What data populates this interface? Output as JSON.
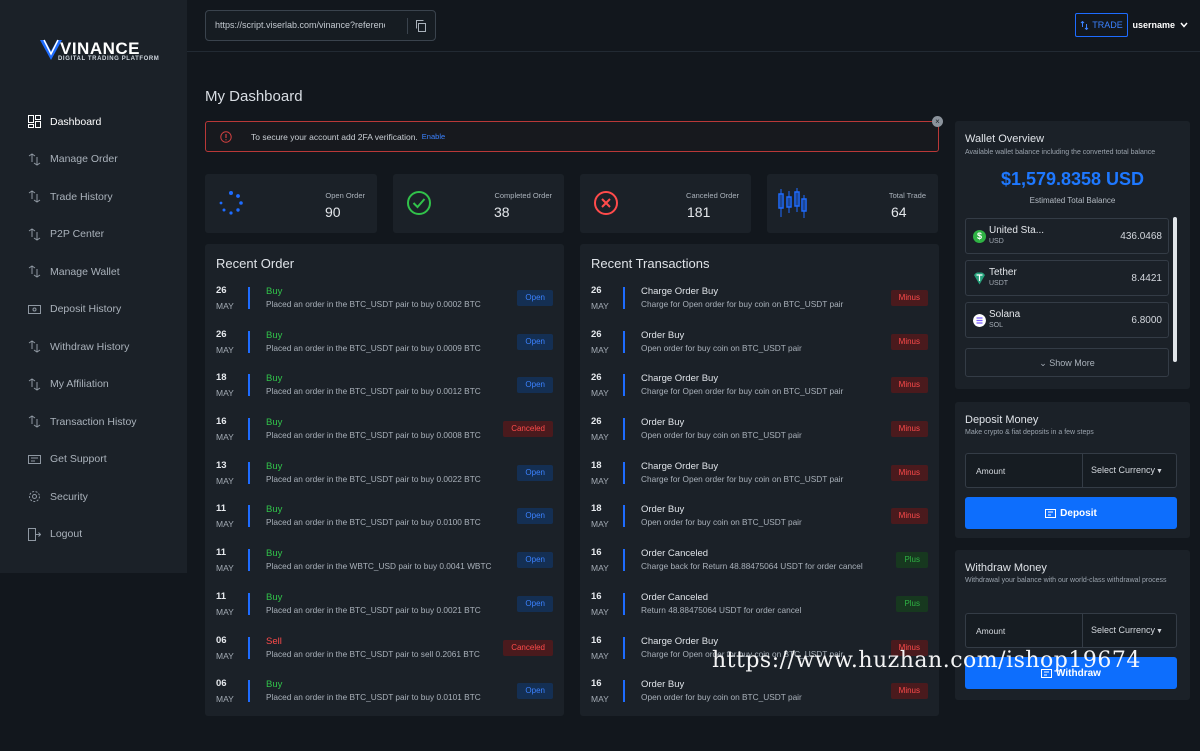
{
  "brand": {
    "name": "VINANCE",
    "tagline": "DIGITAL TRADING PLATFORM"
  },
  "sidebar": {
    "items": [
      {
        "label": "Dashboard",
        "icon": "dashboard-icon"
      },
      {
        "label": "Manage Order",
        "icon": "order-icon"
      },
      {
        "label": "Trade History",
        "icon": "trade-icon"
      },
      {
        "label": "P2P Center",
        "icon": "p2p-icon"
      },
      {
        "label": "Manage Wallet",
        "icon": "wallet-icon"
      },
      {
        "label": "Deposit History",
        "icon": "deposit-icon"
      },
      {
        "label": "Withdraw History",
        "icon": "withdraw-icon"
      },
      {
        "label": "My Affiliation",
        "icon": "affiliation-icon"
      },
      {
        "label": "Transaction Histoy",
        "icon": "transaction-icon"
      },
      {
        "label": "Get Support",
        "icon": "support-icon"
      },
      {
        "label": "Security",
        "icon": "security-icon"
      },
      {
        "label": "Logout",
        "icon": "logout-icon"
      }
    ]
  },
  "topbar": {
    "referral_url": "https://script.viserlab.com/vinance?reference",
    "trade_label": "TRADE",
    "username": "username"
  },
  "page": {
    "title": "My Dashboard",
    "alert_text": "To secure your account add 2FA verification.",
    "alert_link": "Enable"
  },
  "stats": [
    {
      "label": "Open Order",
      "value": "90",
      "icon": "spinner-icon"
    },
    {
      "label": "Completed Order",
      "value": "38",
      "icon": "check-circle-icon"
    },
    {
      "label": "Canceled Order",
      "value": "181",
      "icon": "x-circle-icon"
    },
    {
      "label": "Total Trade",
      "value": "64",
      "icon": "candlestick-icon"
    }
  ],
  "recent_order": {
    "title": "Recent Order",
    "rows": [
      {
        "day": "26",
        "month": "MAY",
        "title": "Buy",
        "desc": "Placed an order in the BTC_USDT pair to buy 0.0002 BTC",
        "status": "Open"
      },
      {
        "day": "26",
        "month": "MAY",
        "title": "Buy",
        "desc": "Placed an order in the BTC_USDT pair to buy 0.0009 BTC",
        "status": "Open"
      },
      {
        "day": "18",
        "month": "MAY",
        "title": "Buy",
        "desc": "Placed an order in the BTC_USDT pair to buy 0.0012 BTC",
        "status": "Open"
      },
      {
        "day": "16",
        "month": "MAY",
        "title": "Buy",
        "desc": "Placed an order in the BTC_USDT pair to buy 0.0008 BTC",
        "status": "Canceled"
      },
      {
        "day": "13",
        "month": "MAY",
        "title": "Buy",
        "desc": "Placed an order in the BTC_USDT pair to buy 0.0022 BTC",
        "status": "Open"
      },
      {
        "day": "11",
        "month": "MAY",
        "title": "Buy",
        "desc": "Placed an order in the BTC_USDT pair to buy 0.0100 BTC",
        "status": "Open"
      },
      {
        "day": "11",
        "month": "MAY",
        "title": "Buy",
        "desc": "Placed an order in the WBTC_USD pair to buy 0.0041 WBTC",
        "status": "Open"
      },
      {
        "day": "11",
        "month": "MAY",
        "title": "Buy",
        "desc": "Placed an order in the BTC_USDT pair to buy 0.0021 BTC",
        "status": "Open"
      },
      {
        "day": "06",
        "month": "MAY",
        "title": "Sell",
        "desc": "Placed an order in the BTC_USDT pair to sell 0.2061 BTC",
        "status": "Canceled"
      },
      {
        "day": "06",
        "month": "MAY",
        "title": "Buy",
        "desc": "Placed an order in the BTC_USDT pair to buy 0.0101 BTC",
        "status": "Open"
      }
    ]
  },
  "recent_transactions": {
    "title": "Recent Transactions",
    "rows": [
      {
        "day": "26",
        "month": "MAY",
        "title": "Charge Order Buy",
        "desc": "Charge for Open order for buy coin on BTC_USDT pair",
        "type": "Minus"
      },
      {
        "day": "26",
        "month": "MAY",
        "title": "Order Buy",
        "desc": "Open order for buy coin on BTC_USDT pair",
        "type": "Minus"
      },
      {
        "day": "26",
        "month": "MAY",
        "title": "Charge Order Buy",
        "desc": "Charge for Open order for buy coin on BTC_USDT pair",
        "type": "Minus"
      },
      {
        "day": "26",
        "month": "MAY",
        "title": "Order Buy",
        "desc": "Open order for buy coin on BTC_USDT pair",
        "type": "Minus"
      },
      {
        "day": "18",
        "month": "MAY",
        "title": "Charge Order Buy",
        "desc": "Charge for Open order for buy coin on BTC_USDT pair",
        "type": "Minus"
      },
      {
        "day": "18",
        "month": "MAY",
        "title": "Order Buy",
        "desc": "Open order for buy coin on BTC_USDT pair",
        "type": "Minus"
      },
      {
        "day": "16",
        "month": "MAY",
        "title": "Order Canceled",
        "desc": "Charge back for Return 48.88475064 USDT for order cancel",
        "type": "Plus"
      },
      {
        "day": "16",
        "month": "MAY",
        "title": "Order Canceled",
        "desc": "Return 48.88475064 USDT for order cancel",
        "type": "Plus"
      },
      {
        "day": "16",
        "month": "MAY",
        "title": "Charge Order Buy",
        "desc": "Charge for Open order for buy coin on BTC_USDT pair",
        "type": "Minus"
      },
      {
        "day": "16",
        "month": "MAY",
        "title": "Order Buy",
        "desc": "Open order for buy coin on BTC_USDT pair",
        "type": "Minus"
      }
    ]
  },
  "wallet": {
    "title": "Wallet Overview",
    "subtitle": "Available wallet balance including the converted total balance",
    "balance": "$1,579.8358 USD",
    "balance_label": "Estimated Total Balance",
    "coins": [
      {
        "name": "United Sta...",
        "symbol": "USD",
        "amount": "436.0468",
        "color": "#2fb344"
      },
      {
        "name": "Tether",
        "symbol": "USDT",
        "amount": "8.4421",
        "color": "#26a17b"
      },
      {
        "name": "Solana",
        "symbol": "SOL",
        "amount": "6.8000",
        "color": "#7b61ff"
      }
    ],
    "show_more": "Show More"
  },
  "deposit": {
    "title": "Deposit Money",
    "subtitle": "Make crypto & fiat deposits in a few steps",
    "amount_placeholder": "Amount",
    "currency_label": "Select Currency",
    "button": "Deposit"
  },
  "withdraw": {
    "title": "Withdraw Money",
    "subtitle": "Withdrawal your balance with our world-class withdrawal process",
    "amount_placeholder": "Amount",
    "currency_label": "Select Currency",
    "button": "Withdraw"
  },
  "watermark": "https://www.huzhan.com/ishop19674",
  "colors": {
    "accent": "#0d6efd",
    "success": "#31c24a",
    "danger": "#ff4b4b",
    "panel": "#1b2128",
    "background": "#12171d"
  }
}
